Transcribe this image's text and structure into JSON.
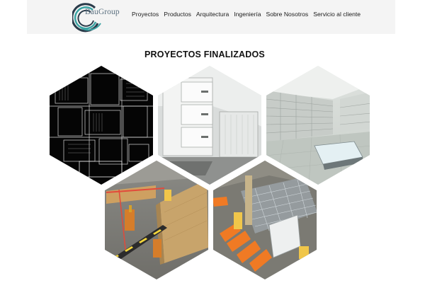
{
  "brand": {
    "name": "BauGroup"
  },
  "nav": {
    "items": [
      {
        "label": "Proyectos"
      },
      {
        "label": "Productos"
      },
      {
        "label": "Arquitectura"
      },
      {
        "label": "Ingeniería"
      },
      {
        "label": "Sobre Nosotros"
      },
      {
        "label": "Servicio al cliente"
      }
    ]
  },
  "section": {
    "title": "PROYECTOS FINALIZADOS"
  },
  "gallery": {
    "items": [
      {
        "icon": "cad-floor-plan-image"
      },
      {
        "icon": "white-cabinet-render-image"
      },
      {
        "icon": "store-shelving-render-image"
      },
      {
        "icon": "construction-wall-render-image"
      },
      {
        "icon": "rebar-installation-render-image"
      }
    ]
  },
  "colors": {
    "nav_background": "#f4f4f4",
    "logo_text": "#5a6f7f",
    "logo_ring_teal": "#3aa3a3",
    "logo_ring_dark": "#2a3b4a",
    "title_text": "#111111"
  }
}
